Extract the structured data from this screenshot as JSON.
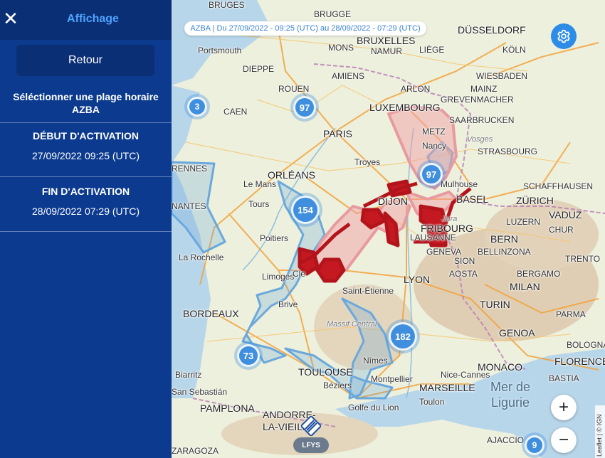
{
  "panel": {
    "title": "Affichage",
    "back_label": "Retour",
    "select_label": "Séléctionner une plage horaire AZBA",
    "start_title": "DÉBUT D'ACTIVATION",
    "start_value": "27/09/2022 09:25 (UTC)",
    "end_title": "FIN D'ACTIVATION",
    "end_value": "28/09/2022 07:29 (UTC)"
  },
  "map": {
    "banner": "AZBA | Du 27/09/2022 - 09:25 (UTC) au 28/09/2022 - 07:29 (UTC)",
    "clusters": [
      "3",
      "97",
      "97",
      "154",
      "182",
      "73",
      "9"
    ],
    "airport_badge": "LFYS",
    "attribution": "Leaflet | © IGN",
    "zoom_in": "+",
    "zoom_out": "−",
    "cities": {
      "bruges": "BRUGES",
      "brugge": "BRUGGE",
      "bruxelles": "BRUXELLES",
      "dusseldorf": "DÜSSELDORF",
      "namur": "NAMUR",
      "mons": "MONS",
      "liege": "LIÈGE",
      "koln": "KÖLN",
      "portsmouth": "Portsmouth",
      "dieppe": "DIEPPE",
      "rouen": "ROUEN",
      "amiens": "AMIENS",
      "arlon": "ARLON",
      "luxembourg": "LUXEMBOURG",
      "wiesbaden": "WIESBADEN",
      "mainz": "MAINZ",
      "grevenmacher": "GREVENMACHER",
      "saarbrucken": "SAARBRUCKEN",
      "metz": "METZ",
      "caen": "CAEN",
      "paris": "PARIS",
      "strasbourg": "STRASBOURG",
      "vosges": "Vosges",
      "nancy": "Nancy",
      "troyes": "Troyes",
      "rennes": "RENNES",
      "le_mans": "Le Mans",
      "orleans": "ORLÉANS",
      "tours": "Tours",
      "dijon": "DIJON",
      "basel": "BASEL",
      "mulhouse": "Mulhouse",
      "schaffhausen": "SCHAFFHAUSEN",
      "zurich": "ZÜRICH",
      "vaduz": "VADUZ",
      "chur": "CHUR",
      "luzern": "LUZERN",
      "bern": "BERN",
      "nantes": "NANTES",
      "poitiers": "Poitiers",
      "jura": "Jura",
      "fribourg": "FRIBOURG",
      "lausanne": "LAUSANNE",
      "geneva": "GENEVA",
      "sion": "SION",
      "bellinzona": "BELLINZONA",
      "la_rochelle": "La Rochelle",
      "limoges": "Limoges",
      "clermont": "Cle",
      "lyon": "LYON",
      "aosta": "AOSTA",
      "trento": "TRENTO",
      "bergamo": "BERGAMO",
      "milan": "MILAN",
      "st_etienne": "Saint-Étienne",
      "bordeaux": "BORDEAUX",
      "brive": "Brive",
      "massif": "Massif Central",
      "turin": "TURIN",
      "genoa": "GENOA",
      "parma": "PARMA",
      "bologna": "BOLOGNA",
      "nimes": "Nîmes",
      "montpellier": "Montpellier",
      "nice": "Nice-Cannes",
      "monaco": "MONACO",
      "florence": "FLORENCE",
      "biarritz": "Biarritz",
      "toulouse": "TOULOUSE",
      "beziers": "Béziers",
      "marseille": "MARSEILLE",
      "toulon": "Toulon",
      "bastia": "BASTIA",
      "san_sebastian": "San Sebastián",
      "pamplona": "PAMPLONA",
      "golfe": "Golfe du Lion",
      "mer": "Mer de Ligurie",
      "andorra": "ANDORRE-LA-VIEILLE",
      "zaragoza": "ZARAGOZA",
      "ajaccio": "AJACCIO"
    }
  }
}
